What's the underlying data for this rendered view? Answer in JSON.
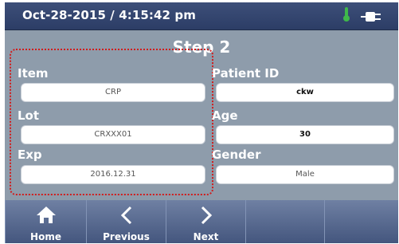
{
  "status_bar": {
    "datetime": "Oct-28-2015 / 4:15:42 pm",
    "icons": [
      "thermometer-icon",
      "plug-icon"
    ],
    "thermometer_color": "#3fb84a"
  },
  "step_title": "Step 2",
  "left_fields": [
    {
      "label": "Item",
      "value": "CRP"
    },
    {
      "label": "Lot",
      "value": "CRXXX01"
    },
    {
      "label": "Exp",
      "value": "2016.12.31"
    }
  ],
  "right_fields": [
    {
      "label": "Patient ID",
      "value": "ckw"
    },
    {
      "label": "Age",
      "value": "30"
    },
    {
      "label": "Gender",
      "value": "Male"
    }
  ],
  "nav": {
    "home": {
      "label": "Home",
      "icon": "home-icon"
    },
    "previous": {
      "label": "Previous",
      "icon": "chevron-left-icon"
    },
    "next": {
      "label": "Next",
      "icon": "chevron-right-icon"
    }
  },
  "colors": {
    "background": "#8e9cab",
    "status_bar": "#2c3d66",
    "highlight_frame": "#d11c1c"
  }
}
